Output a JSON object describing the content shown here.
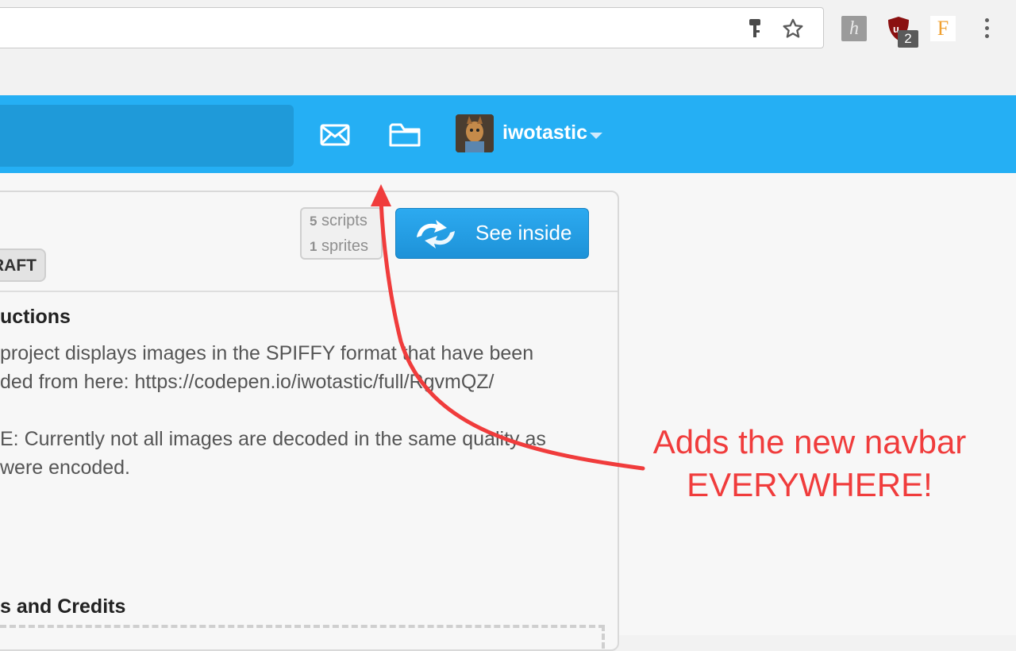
{
  "browser": {
    "extensions": {
      "hypothesis_glyph": "h",
      "ublock_badge": "2",
      "fontface_glyph": "F"
    }
  },
  "navbar": {
    "username": "iwotastic",
    "icons": [
      "mail-icon",
      "folder-icon"
    ],
    "background": "#25aff4"
  },
  "project": {
    "stats": {
      "scripts_count": "5",
      "scripts_label": "scripts",
      "sprites_count": "1",
      "sprites_label": "sprites"
    },
    "see_inside_label": "See inside",
    "draft_label": "RAFT",
    "instructions_heading": "uctions",
    "instructions_lines": [
      "project displays images in the SPIFFY format that have been",
      "ded from here: https://codepen.io/iwotastic/full/RgvmQZ/",
      "E: Currently not all images are decoded in the same quality as",
      "were encoded."
    ],
    "notes_heading": "s and Credits"
  },
  "annotation": {
    "line1": "Adds the new navbar",
    "line2": "EVERYWHERE!",
    "color": "#f03c3c"
  }
}
